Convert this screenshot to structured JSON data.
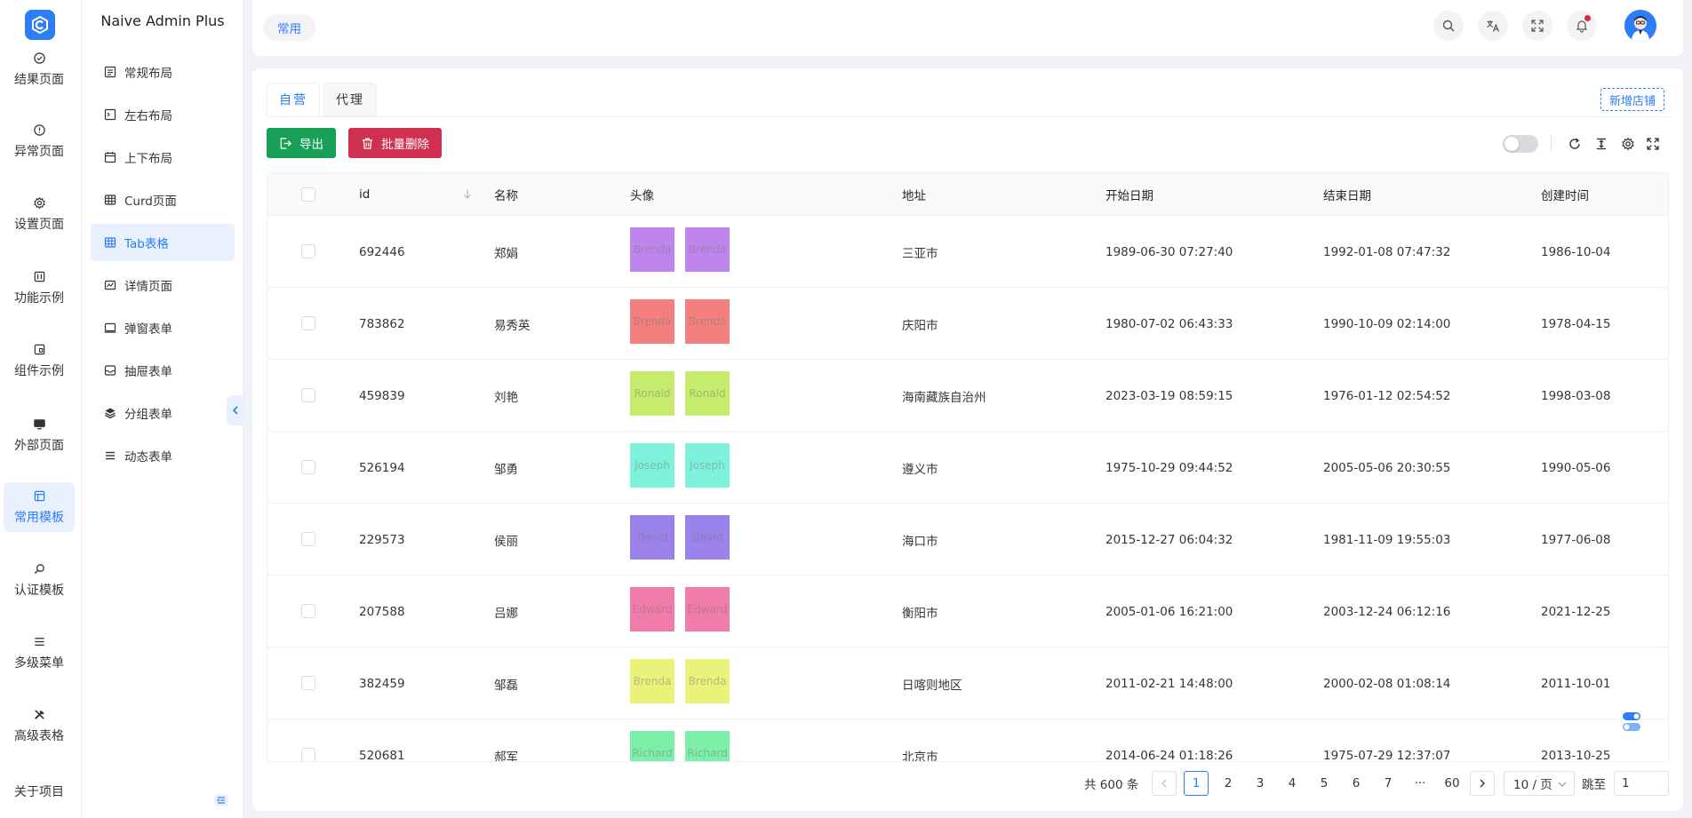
{
  "app": {
    "name": "Naive Admin Plus",
    "colors": {
      "primary": "#2d7df6",
      "success": "#18a058",
      "error": "#d03050",
      "badge": "#e0283a"
    }
  },
  "rail": {
    "items": [
      {
        "label": "结果页面",
        "icon": "check-circle-icon"
      },
      {
        "label": "异常页面",
        "icon": "warning-circle-icon"
      },
      {
        "label": "设置页面",
        "icon": "gear-icon"
      },
      {
        "label": "功能示例",
        "icon": "function-icon"
      },
      {
        "label": "组件示例",
        "icon": "component-icon"
      },
      {
        "label": "外部页面",
        "icon": "monitor-icon"
      },
      {
        "label": "常用模板",
        "icon": "template-icon",
        "active": true
      },
      {
        "label": "认证模板",
        "icon": "search-icon"
      },
      {
        "label": "多级菜单",
        "icon": "menu-icon"
      },
      {
        "label": "高级表格",
        "icon": "tools-icon"
      },
      {
        "label": "关于项目",
        "icon": "info-icon"
      }
    ]
  },
  "submenu": {
    "items": [
      {
        "label": "常规布局",
        "icon": "layout-icon"
      },
      {
        "label": "左右布局",
        "icon": "split-layout-icon"
      },
      {
        "label": "上下布局",
        "icon": "calendar-icon"
      },
      {
        "label": "Curd页面",
        "icon": "table-icon"
      },
      {
        "label": "Tab表格",
        "icon": "table-icon",
        "active": true
      },
      {
        "label": "详情页面",
        "icon": "detail-icon"
      },
      {
        "label": "弹窗表单",
        "icon": "window-icon"
      },
      {
        "label": "抽屉表单",
        "icon": "drawer-icon"
      },
      {
        "label": "分组表单",
        "icon": "layers-icon"
      },
      {
        "label": "动态表单",
        "icon": "list-icon"
      }
    ]
  },
  "header": {
    "tag": "常用",
    "actions": [
      "search-icon",
      "translate-icon",
      "fullscreen-icon",
      "bell-icon"
    ]
  },
  "tabs": [
    {
      "label": "自营",
      "active": true
    },
    {
      "label": "代理",
      "active": false
    }
  ],
  "toolbar": {
    "add_shop": "新增店铺",
    "export": "导出",
    "bulk_delete": "批量删除",
    "tools": [
      "refresh-icon",
      "column-height-icon",
      "settings-icon",
      "fullscreen-icon"
    ]
  },
  "table": {
    "columns": [
      "id",
      "名称",
      "头像",
      "地址",
      "开始日期",
      "结束日期",
      "创建时间"
    ],
    "rows": [
      {
        "id": "692446",
        "name": "郑娟",
        "avatar_text": "Brenda",
        "avatar_color": "#c084ee",
        "address": "三亚市",
        "start": "1989-06-30 07:27:40",
        "end": "1992-01-08 07:47:32",
        "created": "1986-10-04"
      },
      {
        "id": "783862",
        "name": "易秀英",
        "avatar_text": "Brenda",
        "avatar_color": "#f47f7f",
        "address": "庆阳市",
        "start": "1980-07-02 06:43:33",
        "end": "1990-10-09 02:14:00",
        "created": "1978-04-15"
      },
      {
        "id": "459839",
        "name": "刘艳",
        "avatar_text": "Ronald",
        "avatar_color": "#c5ec6c",
        "address": "海南藏族自治州",
        "start": "2023-03-19 08:59:15",
        "end": "1976-01-12 02:54:52",
        "created": "1998-03-08"
      },
      {
        "id": "526194",
        "name": "邹勇",
        "avatar_text": "Joseph",
        "avatar_color": "#7ef2dd",
        "address": "遵义市",
        "start": "1975-10-29 09:44:52",
        "end": "2005-05-06 20:30:55",
        "created": "1990-05-06"
      },
      {
        "id": "229573",
        "name": "侯丽",
        "avatar_text": "David",
        "avatar_color": "#9b82ea",
        "address": "海口市",
        "start": "2015-12-27 06:04:32",
        "end": "1981-11-09 19:55:03",
        "created": "1977-06-08"
      },
      {
        "id": "207588",
        "name": "吕娜",
        "avatar_text": "Edward",
        "avatar_color": "#f17cab",
        "address": "衡阳市",
        "start": "2005-01-06 16:21:00",
        "end": "2003-12-24 06:12:16",
        "created": "2021-12-25"
      },
      {
        "id": "382459",
        "name": "邹磊",
        "avatar_text": "Brenda",
        "avatar_color": "#eaf27a",
        "address": "日喀则地区",
        "start": "2011-02-21 14:48:00",
        "end": "2000-02-08 01:08:14",
        "created": "2011-10-01"
      },
      {
        "id": "520681",
        "name": "郝军",
        "avatar_text": "Richard",
        "avatar_color": "#7cf0a8",
        "address": "北京市",
        "start": "2014-06-24 01:18:26",
        "end": "1975-07-29 12:37:07",
        "created": "2013-10-25"
      }
    ]
  },
  "pagination": {
    "total": "共 600 条",
    "pages": [
      "1",
      "2",
      "3",
      "4",
      "5",
      "6",
      "7",
      "···",
      "60"
    ],
    "current": "1",
    "page_size": "10 / 页",
    "jump_label": "跳至",
    "jump_value": "1"
  }
}
